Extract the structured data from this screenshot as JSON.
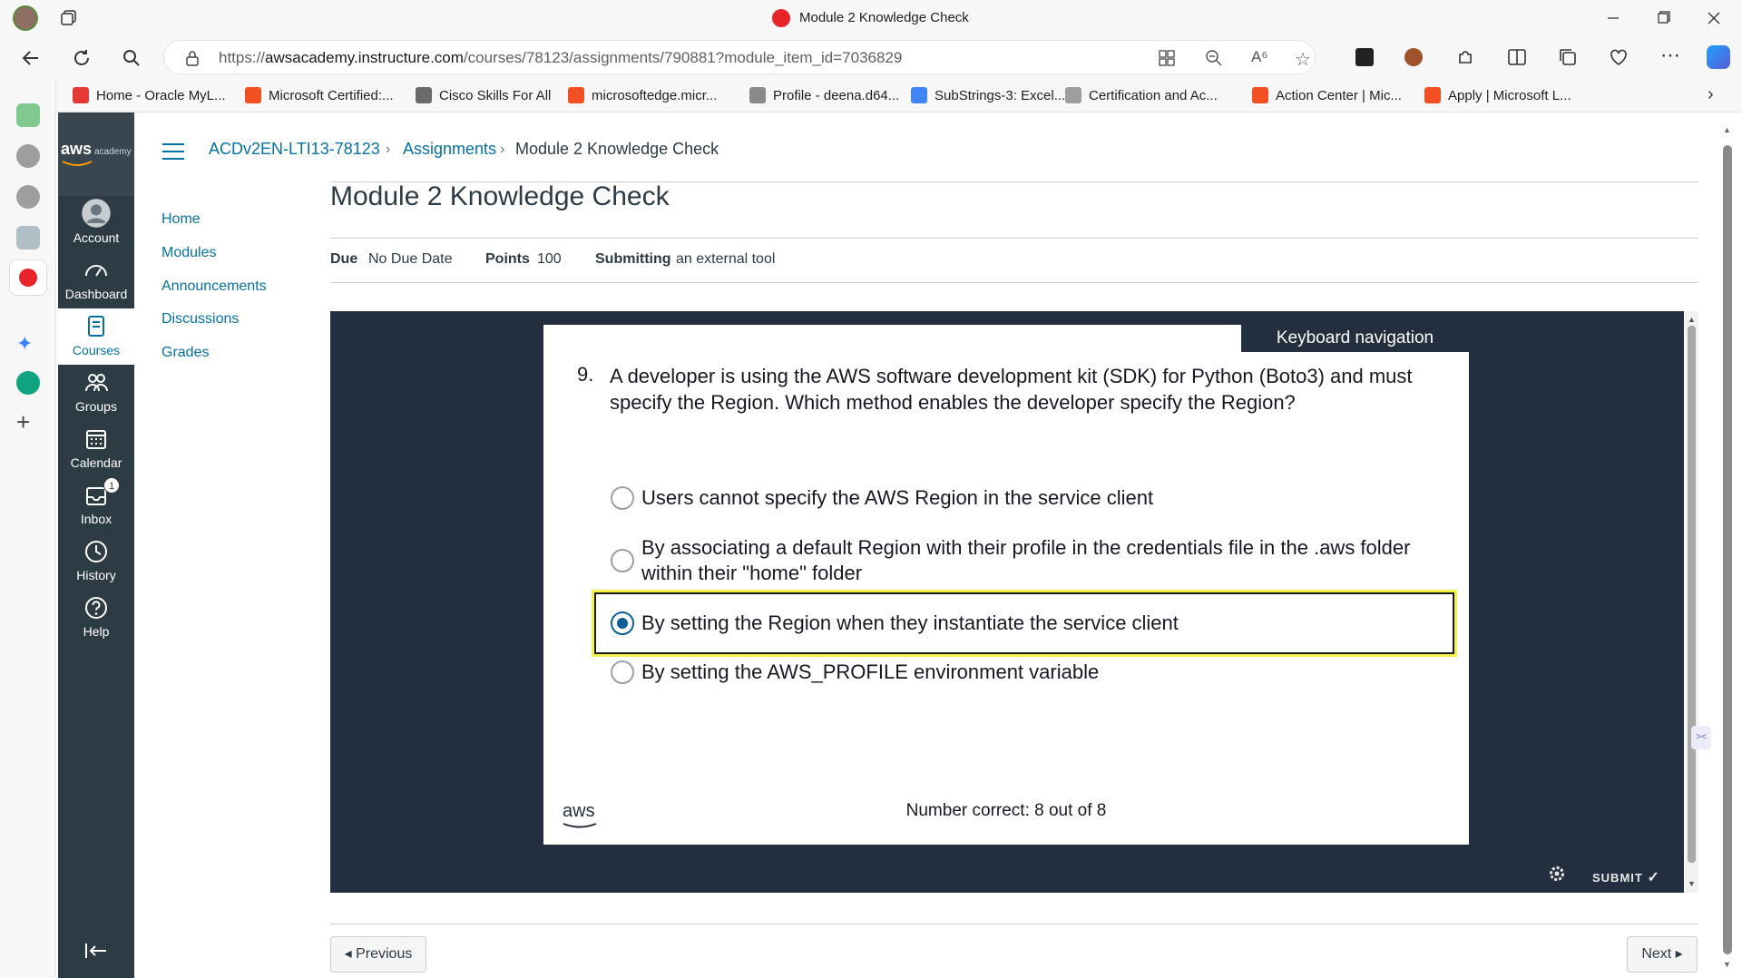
{
  "browser": {
    "tab_title": "Module 2 Knowledge Check",
    "url_prefix": "https://",
    "url_domain": "awsacademy.instructure.com",
    "url_path": "/courses/78123/assignments/790881?module_item_id=7036829",
    "favorites": [
      {
        "label": "Home - Oracle MyL...",
        "color": "#e53935"
      },
      {
        "label": "Microsoft Certified:...",
        "color": "#f25022"
      },
      {
        "label": "Cisco Skills For All",
        "color": "#6b6b6b"
      },
      {
        "label": "microsoftedge.micr...",
        "color": "#f25022"
      },
      {
        "label": "Profile - deena.d64...",
        "color": "#8a8a8a"
      },
      {
        "label": "SubStrings-3: Excel...",
        "color": "#4285f4"
      },
      {
        "label": "Certification and Ac...",
        "color": "#9e9e9e"
      },
      {
        "label": "Action Center | Mic...",
        "color": "#f25022"
      },
      {
        "label": "Apply | Microsoft L...",
        "color": "#f25022"
      }
    ]
  },
  "global_nav": {
    "logo_text": "aws",
    "logo_sub": "academy",
    "items": [
      {
        "label": "Account",
        "icon": "account-icon"
      },
      {
        "label": "Dashboard",
        "icon": "dashboard-icon"
      },
      {
        "label": "Courses",
        "icon": "courses-icon"
      },
      {
        "label": "Groups",
        "icon": "groups-icon"
      },
      {
        "label": "Calendar",
        "icon": "calendar-icon"
      },
      {
        "label": "Inbox",
        "icon": "inbox-icon"
      },
      {
        "label": "History",
        "icon": "history-icon"
      },
      {
        "label": "Help",
        "icon": "help-icon"
      }
    ],
    "inbox_badge": "1"
  },
  "breadcrumb": {
    "course": "ACDv2EN-LTI13-78123",
    "section": "Assignments",
    "current": "Module 2 Knowledge Check"
  },
  "course_nav": [
    "Home",
    "Modules",
    "Announcements",
    "Discussions",
    "Grades"
  ],
  "assignment": {
    "title": "Module 2 Knowledge Check",
    "due_label": "Due",
    "due_value": "No Due Date",
    "points_label": "Points",
    "points_value": "100",
    "submitting_label": "Submitting",
    "submitting_value": "an external tool"
  },
  "quiz": {
    "keyboard_nav": "Keyboard navigation",
    "number": "9.",
    "question": "A developer is using the AWS software development kit (SDK) for Python (Boto3) and must specify the Region. Which method enables the developer specify the Region?",
    "options": [
      "Users cannot specify the AWS Region in the service client",
      "By associating a default Region with their profile in the credentials file in the .aws folder within their \"home\" folder",
      "By setting the Region when they instantiate the service client",
      "By setting the AWS_PROFILE environment variable"
    ],
    "selected_index": 2,
    "score": "Number correct: 8 out of 8",
    "footer_logo": "aws",
    "submit": "SUBMIT"
  },
  "pager": {
    "previous": "◂ Previous",
    "next": "Next ▸"
  }
}
